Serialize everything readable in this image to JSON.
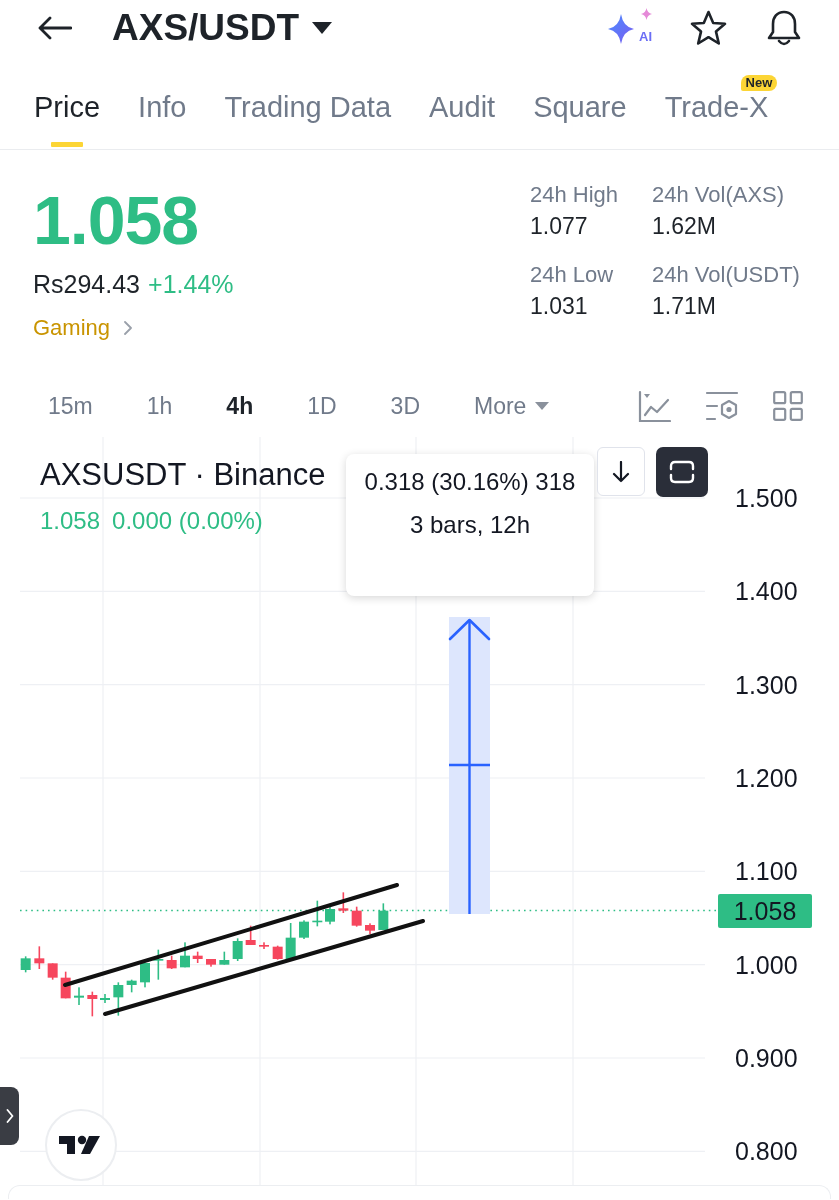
{
  "header": {
    "title": "AXS/USDT",
    "ai_label": "AI"
  },
  "tabs": [
    {
      "label": "Price",
      "selected": true
    },
    {
      "label": "Info",
      "selected": false
    },
    {
      "label": "Trading Data",
      "selected": false
    },
    {
      "label": "Audit",
      "selected": false
    },
    {
      "label": "Square",
      "selected": false
    },
    {
      "label": "Trade-X",
      "selected": false,
      "badge": "New"
    }
  ],
  "ticker": {
    "last_price": "1.058",
    "fiat_price": "Rs294.43",
    "change": "+1.44%",
    "category": "Gaming",
    "stats": [
      {
        "label": "24h High",
        "value": "1.077"
      },
      {
        "label": "24h Vol(AXS)",
        "value": "1.62M"
      },
      {
        "label": "24h Low",
        "value": "1.031"
      },
      {
        "label": "24h Vol(USDT)",
        "value": "1.71M"
      }
    ]
  },
  "intervals": [
    {
      "label": "15m",
      "kind": "interval",
      "selected": false
    },
    {
      "label": "1h",
      "kind": "interval",
      "selected": false
    },
    {
      "label": "4h",
      "kind": "interval",
      "selected": true
    },
    {
      "label": "1D",
      "kind": "interval",
      "selected": false
    },
    {
      "label": "3D",
      "kind": "interval",
      "selected": false
    },
    {
      "label": "More",
      "kind": "dropdown",
      "selected": false
    }
  ],
  "chart": {
    "symbol": "AXSUSDT · Binance",
    "last_value": "1.058",
    "change": "0.000 (0.00%)",
    "measure_tooltip": {
      "change": "0.318 (30.16%) 318",
      "span": "3 bars, 12h"
    },
    "price_axis": [
      "1.500",
      "1.400",
      "1.300",
      "1.200",
      "1.100",
      "1.000",
      "0.900",
      "0.800"
    ],
    "price_tag": "1.058"
  }
}
